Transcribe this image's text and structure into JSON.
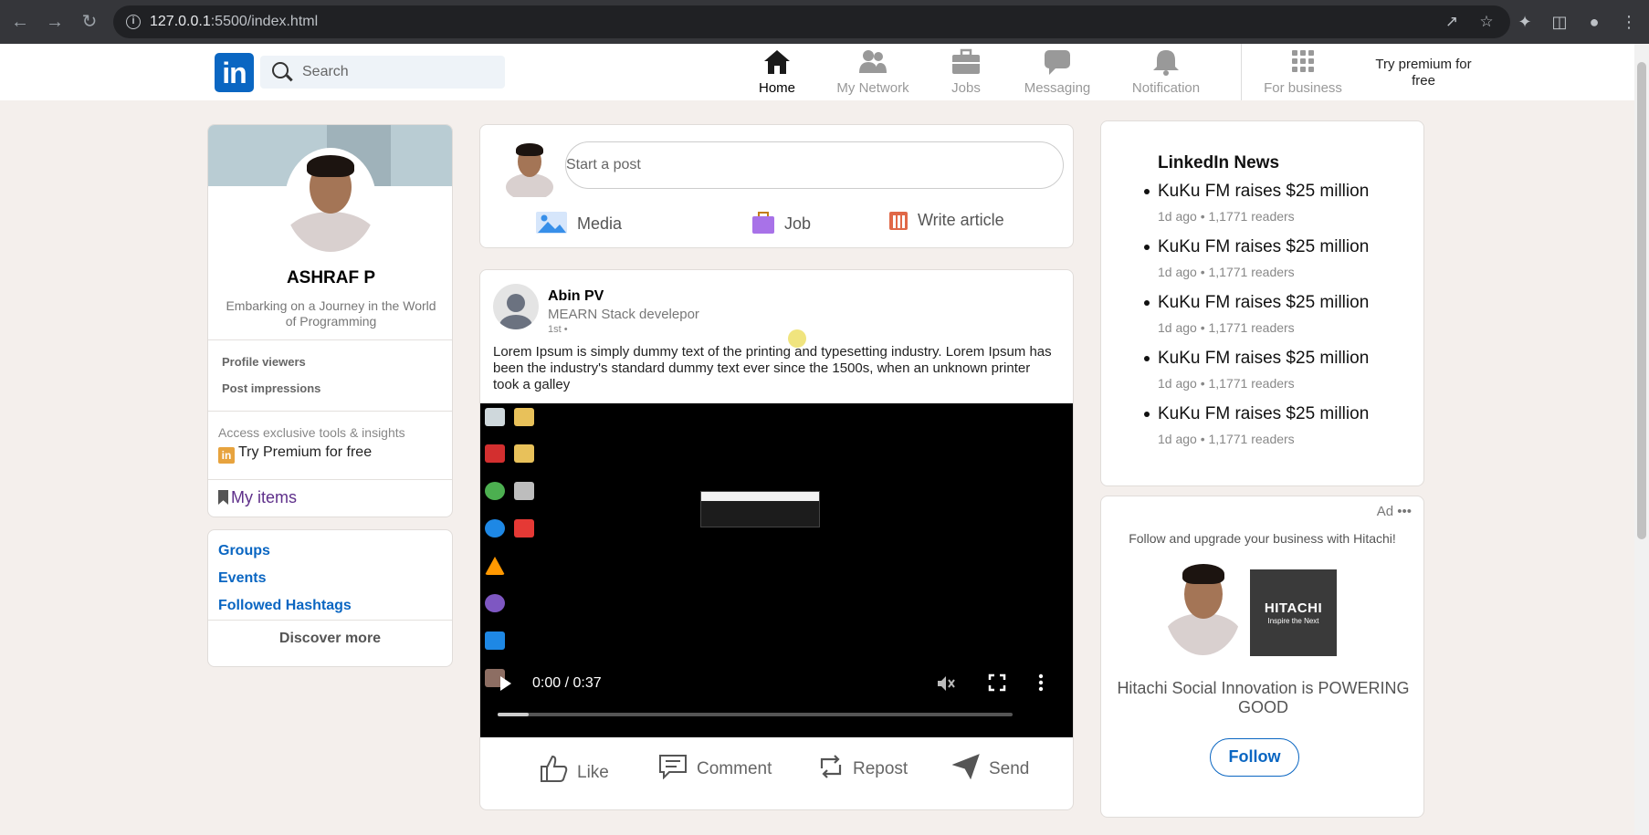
{
  "browser": {
    "url_host": "127.0.0.1",
    "url_path": ":5500/index.html"
  },
  "header": {
    "logo_text": "in",
    "search_placeholder": "Search",
    "nav": [
      {
        "label": "Home",
        "icon": "home-icon",
        "active": true
      },
      {
        "label": "My Network",
        "icon": "network-icon",
        "active": false
      },
      {
        "label": "Jobs",
        "icon": "briefcase-icon",
        "active": false
      },
      {
        "label": "Messaging",
        "icon": "chat-icon",
        "active": false
      },
      {
        "label": "Notification",
        "icon": "bell-icon",
        "active": false
      },
      {
        "label": "For business",
        "icon": "grid-icon",
        "active": false
      }
    ],
    "premium": "Try premium for free"
  },
  "profile": {
    "name": "ASHRAF P",
    "headline": "Embarking on a Journey in the World of Programming",
    "stats": [
      "Profile viewers",
      "Post impressions"
    ],
    "access_text": "Access exclusive tools & insights",
    "premium_link": "Try Premium for free",
    "my_items": "My items"
  },
  "groups": {
    "links": [
      "Groups",
      "Events",
      "Followed Hashtags"
    ],
    "discover": "Discover more"
  },
  "start_post": {
    "placeholder": "Start a post",
    "media": "Media",
    "job": "Job",
    "article": "Write article"
  },
  "post": {
    "author": "Abin PV",
    "role": "MEARN Stack develepor",
    "connection": "1st •",
    "text": "Lorem Ipsum is simply dummy text of the printing and typesetting industry. Lorem Ipsum has been the industry's standard dummy text ever since the 1500s, when an unknown printer took a galley",
    "video_time": "0:00 / 0:37",
    "video_progress": 0.06,
    "actions": [
      "Like",
      "Comment",
      "Repost",
      "Send"
    ]
  },
  "news": {
    "title": "LinkedIn News",
    "items": [
      {
        "headline": "KuKu FM raises $25 million",
        "meta": "1d ago • 1,1771 readers"
      },
      {
        "headline": "KuKu FM raises $25 million",
        "meta": "1d ago • 1,1771 readers"
      },
      {
        "headline": "KuKu FM raises $25 million",
        "meta": "1d ago • 1,1771 readers"
      },
      {
        "headline": "KuKu FM raises $25 million",
        "meta": "1d ago • 1,1771 readers"
      },
      {
        "headline": "KuKu FM raises $25 million",
        "meta": "1d ago • 1,1771 readers"
      }
    ]
  },
  "ad": {
    "label": "Ad •••",
    "tagline": "Follow and upgrade your business with Hitachi!",
    "brand": "HITACHI",
    "brand_slogan": "Inspire the Next",
    "title": "Hitachi Social Innovation is POWERING GOOD",
    "follow": "Follow"
  },
  "colors": {
    "brand": "#0a66c2",
    "background": "#f4efec"
  }
}
